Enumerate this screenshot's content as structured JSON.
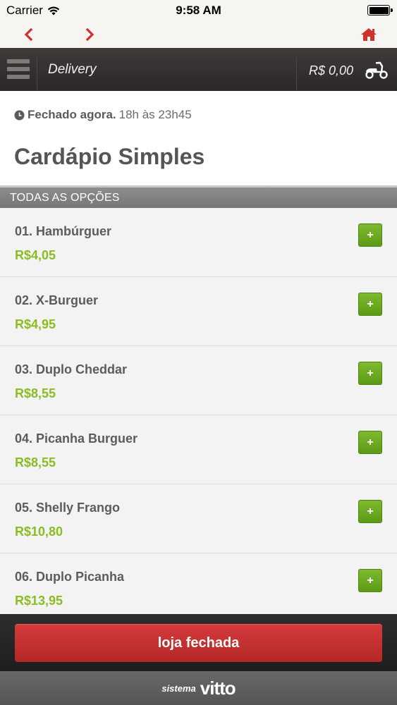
{
  "status_bar": {
    "carrier": "Carrier",
    "time": "9:58 AM",
    "battery_level": 1.0
  },
  "browser_nav": {
    "back_icon": "chevron-left-icon",
    "forward_icon": "chevron-right-icon",
    "home_icon": "home-icon",
    "icon_color": "#d0312d"
  },
  "header": {
    "menu_icon": "hamburger-menu-icon",
    "title": "Delivery",
    "cart_total": "R$ 0,00",
    "delivery_icon": "scooter-icon"
  },
  "store_info": {
    "status_icon": "clock-icon",
    "status": "Fechado agora.",
    "hours": "18h às 23h45",
    "menu_title": "Cardápio Simples"
  },
  "section": {
    "title": "TODAS AS OPÇÕES"
  },
  "items": [
    {
      "name": "01. Hambúrguer",
      "price": "R$4,05",
      "add_label": "+"
    },
    {
      "name": "02. X-Burguer",
      "price": "R$4,95",
      "add_label": "+"
    },
    {
      "name": "03. Duplo Cheddar",
      "price": "R$8,55",
      "add_label": "+"
    },
    {
      "name": "04. Picanha Burguer",
      "price": "R$8,55",
      "add_label": "+"
    },
    {
      "name": "05. Shelly Frango",
      "price": "R$10,80",
      "add_label": "+"
    },
    {
      "name": "06. Duplo Picanha",
      "price": "R$13,95",
      "add_label": "+"
    }
  ],
  "bottom_bar": {
    "closed_label": "loja fechada"
  },
  "footer": {
    "prefix": "sistema",
    "brand": "vitto"
  },
  "colors": {
    "accent_red": "#d0312d",
    "price_green": "#8cbc23",
    "add_button_green": "#6aaa20",
    "header_dark": "#333130"
  }
}
